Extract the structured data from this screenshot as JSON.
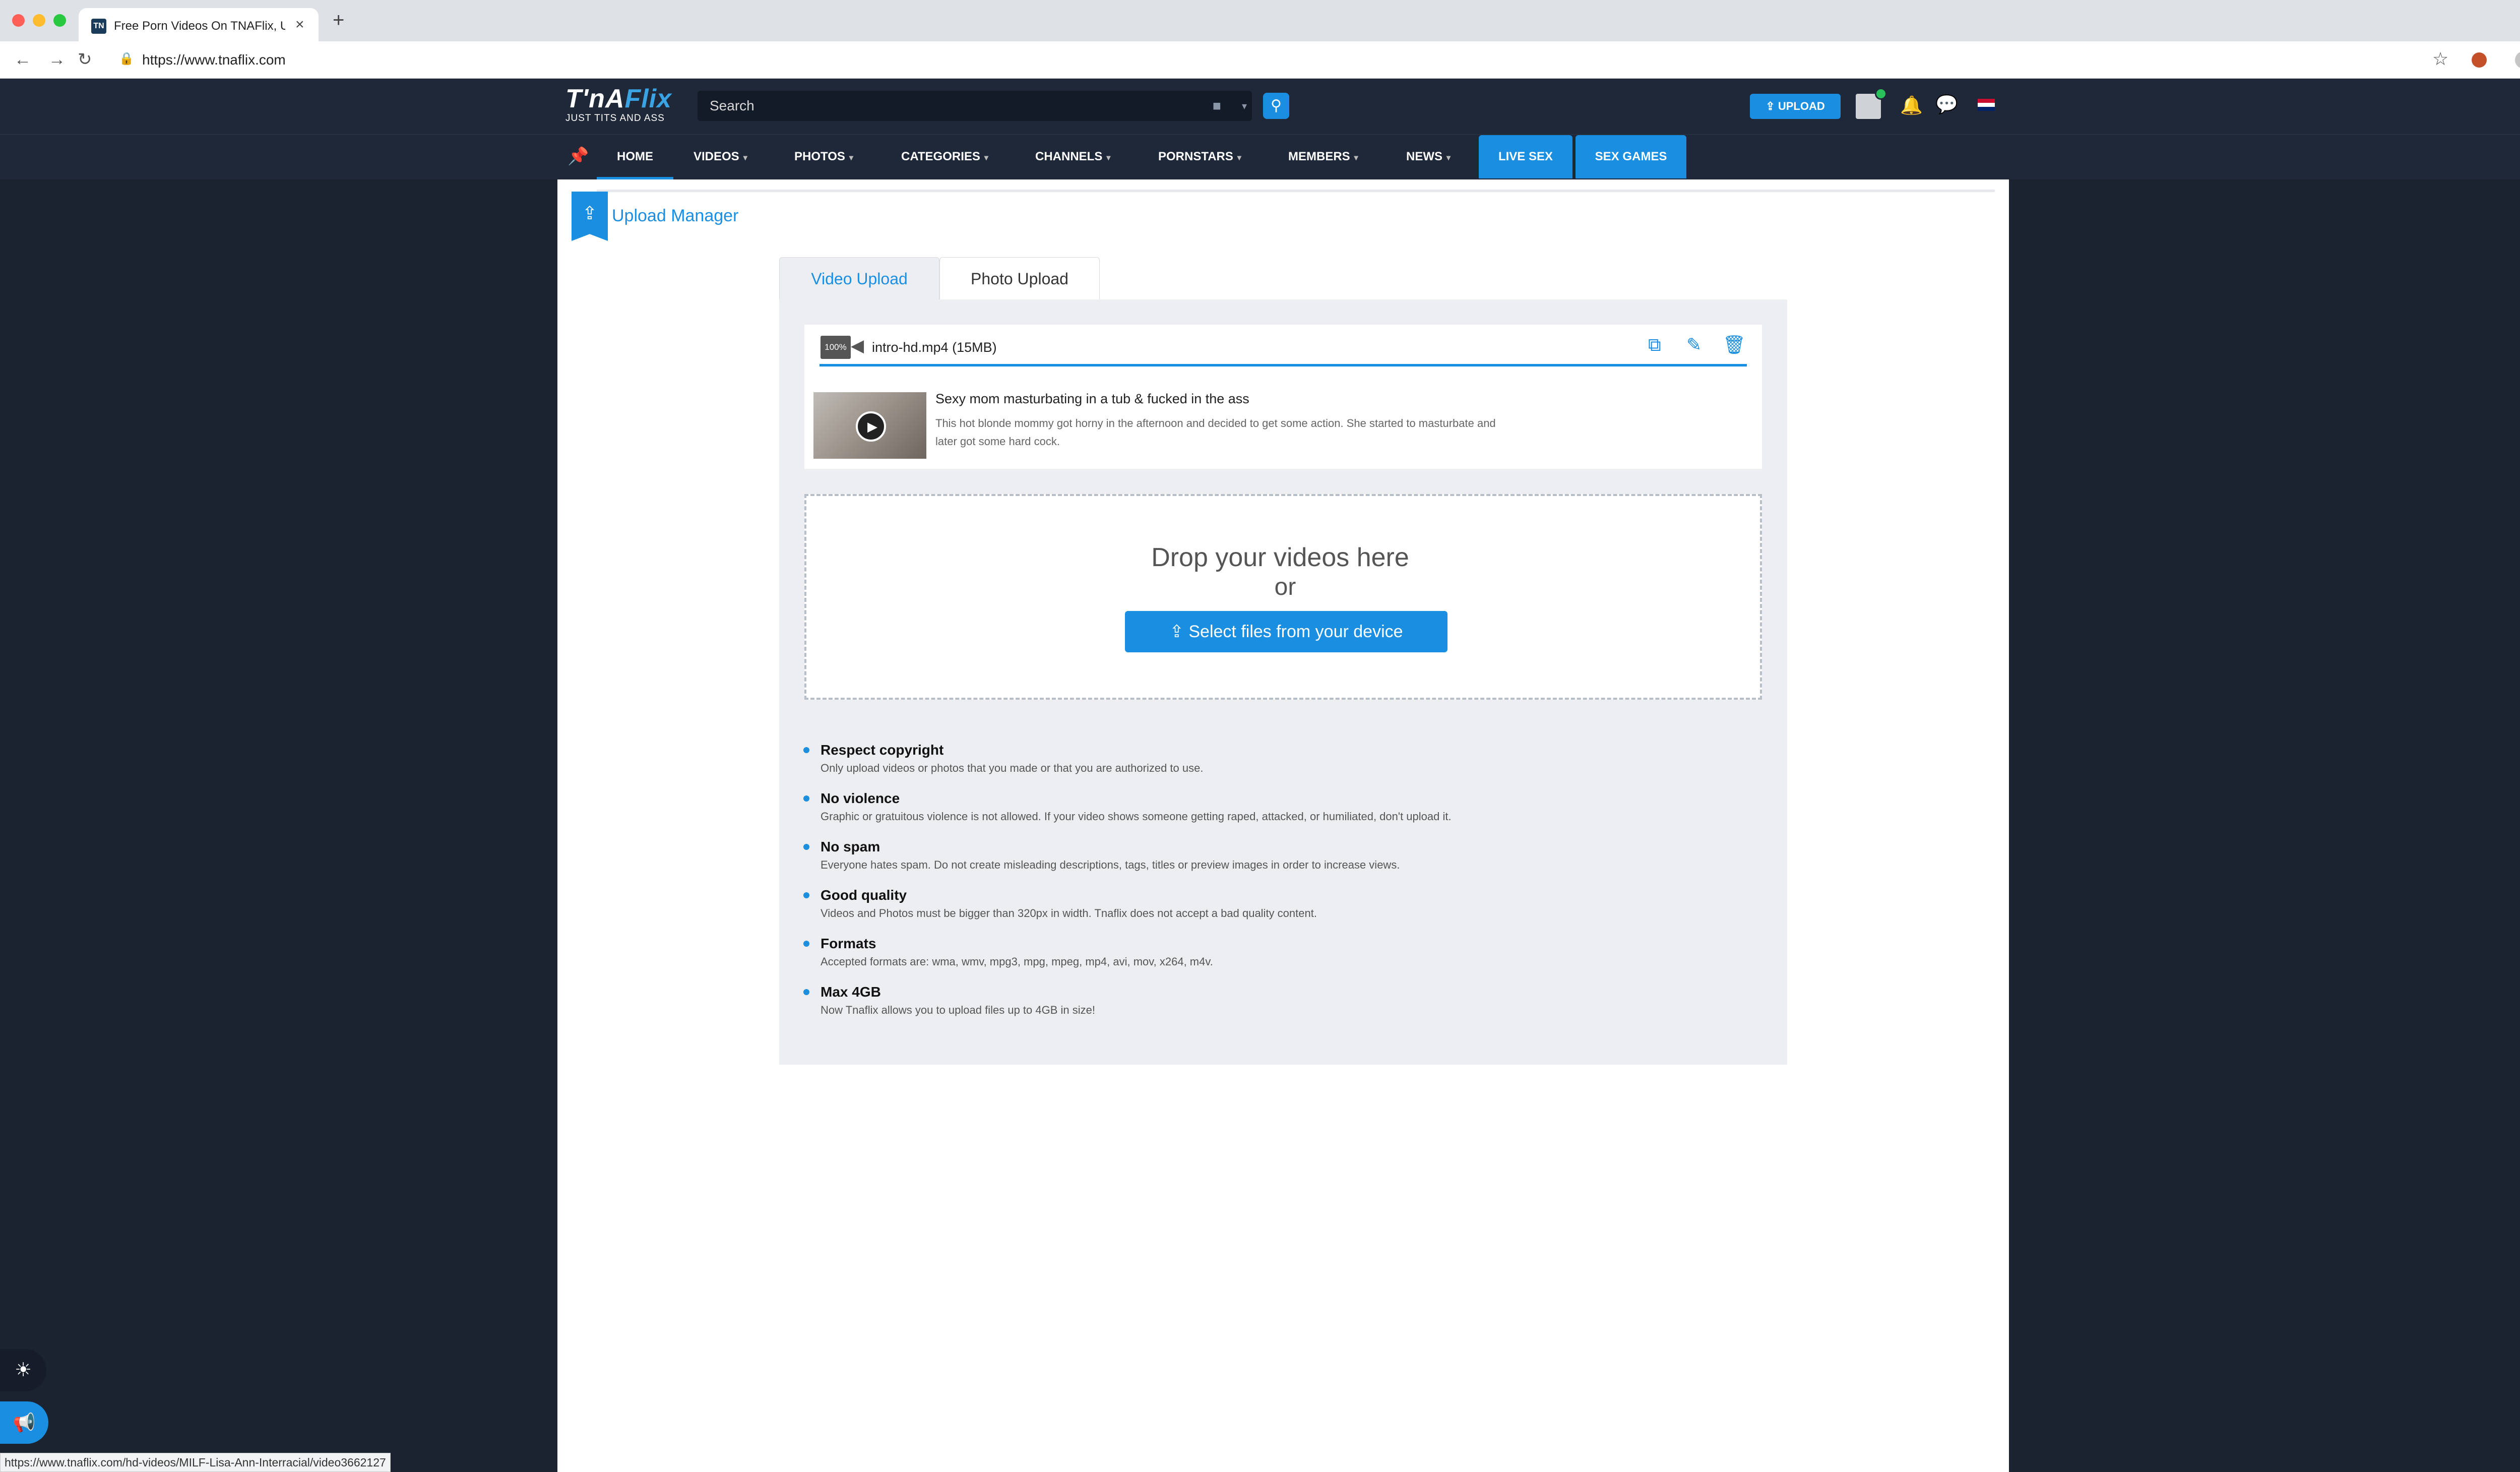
{
  "browser": {
    "tab_title": "Free Porn Videos On TNAFlix, U",
    "tab_favicon": "TN",
    "close_glyph": "×",
    "new_tab_glyph": "+",
    "url": "https://www.tnaflix.com",
    "back_glyph": "←",
    "forward_glyph": "→",
    "reload_glyph": "↻",
    "lock_glyph": "🔒",
    "star_glyph": "☆",
    "more_glyph": "⋮",
    "status_url": "https://www.tnaflix.com/hd-videos/MILF-Lisa-Ann-Interracial/video3662127"
  },
  "header": {
    "logo_main": "T'nA",
    "logo_flix": "Flix",
    "logo_tagline": "JUST TITS AND ASS",
    "search_placeholder": "Search",
    "search_icon": "search-icon",
    "search_glyph": "⚲",
    "camera_glyph": "■",
    "caret_glyph": "▾",
    "upload_label": "⇪ UPLOAD",
    "bell_glyph": "🔔",
    "chat_glyph": "💬"
  },
  "nav": {
    "pin_glyph": "📌",
    "items": [
      {
        "label": "HOME",
        "caret": ""
      },
      {
        "label": "VIDEOS",
        "caret": "▾"
      },
      {
        "label": "PHOTOS",
        "caret": "▾"
      },
      {
        "label": "CATEGORIES",
        "caret": "▾"
      },
      {
        "label": "CHANNELS",
        "caret": "▾"
      },
      {
        "label": "PORNSTARS",
        "caret": "▾"
      },
      {
        "label": "MEMBERS",
        "caret": "▾"
      },
      {
        "label": "NEWS",
        "caret": "▾"
      }
    ],
    "live_sex": "LIVE SEX",
    "sex_games": "SEX GAMES"
  },
  "upload_manager": {
    "badge_glyph": "⇪",
    "title": "Upload Manager",
    "tabs": {
      "video": "Video Upload",
      "photo": "Photo Upload"
    },
    "file": {
      "percent_label": "100%",
      "progress": 1.0,
      "speaker_glyph": "◀",
      "name": "intro-hd.mp4 (15MB)",
      "copy_glyph": "⧉",
      "edit_glyph": "✎",
      "delete_glyph": "🗑",
      "play_glyph": "▶",
      "video_title": "Sexy mom masturbating in a tub & fucked in the ass",
      "video_description": "This hot blonde mommy got horny in the afternoon and decided to get some action. She started to masturbate and later got some hard cock."
    },
    "dropzone": {
      "title": "Drop your videos here",
      "or": "or",
      "button": "⇪  Select files from your device"
    },
    "rules": [
      {
        "title": "Respect copyright",
        "text": "Only upload videos or photos that you made or that you are authorized to use."
      },
      {
        "title": "No violence",
        "text": "Graphic or gratuitous violence is not allowed. If your video shows someone getting raped, attacked, or humiliated, don't upload it."
      },
      {
        "title": "No spam",
        "text": "Everyone hates spam. Do not create misleading descriptions, tags, titles or preview images in order to increase views."
      },
      {
        "title": "Good quality",
        "text": "Videos and Photos must be bigger than 320px in width. Tnaflix does not accept a bad quality content."
      },
      {
        "title": "Formats",
        "text": "Accepted formats are: wma, wmv, mpg3, mpg, mpeg, mp4, avi, mov, x264, m4v."
      },
      {
        "title": "Max 4GB",
        "text": "Now Tnaflix allows you to upload files up to 4GB in size!"
      }
    ]
  },
  "floating": {
    "theme_glyph": "☀",
    "promo_glyph": "📢"
  },
  "colors": {
    "accent": "#1a8ee1",
    "header_bg": "#1e2838",
    "page_bg": "#1b2331",
    "panel_bg": "#eceef1"
  }
}
